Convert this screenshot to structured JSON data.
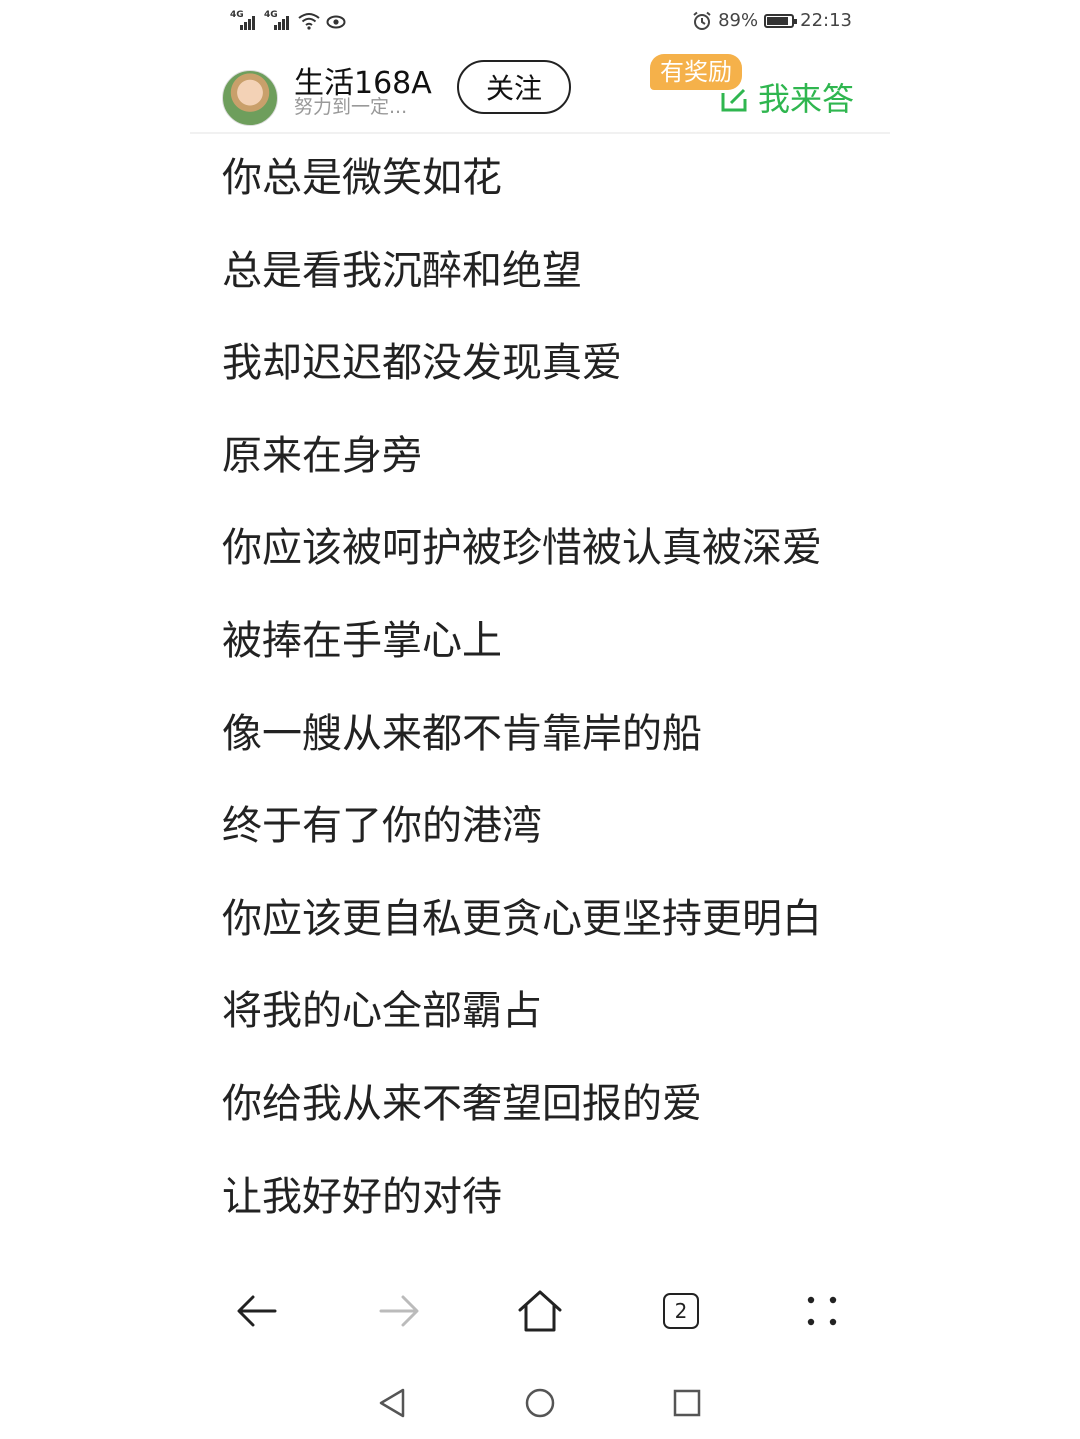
{
  "status_bar": {
    "network_1": "4G",
    "network_2": "4G",
    "battery_percent": "89%",
    "battery_level": 0.89,
    "time": "22:13"
  },
  "header": {
    "username": "生活168A",
    "subtitle": "努力到一定...",
    "follow_label": "关注",
    "reward_badge": "有奖励",
    "answer_label": "我来答",
    "answer_color": "#2fb64f",
    "reward_color": "#f5b14a"
  },
  "lyrics": [
    "你总是微笑如花",
    "总是看我沉醉和绝望",
    "我却迟迟都没发现真爱",
    "原来在身旁",
    "你应该被呵护被珍惜被认真被深爱",
    "被捧在手掌心上",
    "像一艘从来都不肯靠岸的船",
    "终于有了你的港湾",
    "你应该更自私更贪心更坚持更明白",
    "将我的心全部霸占",
    "你给我从来不奢望回报的爱",
    "让我好好的对待"
  ],
  "toolbar": {
    "tab_count": "2",
    "icons": [
      "back-arrow-icon",
      "forward-arrow-icon",
      "home-icon",
      "tabs-icon",
      "more-icon"
    ]
  },
  "system_nav": {
    "icons": [
      "nav-back-icon",
      "nav-home-icon",
      "nav-recents-icon"
    ]
  }
}
